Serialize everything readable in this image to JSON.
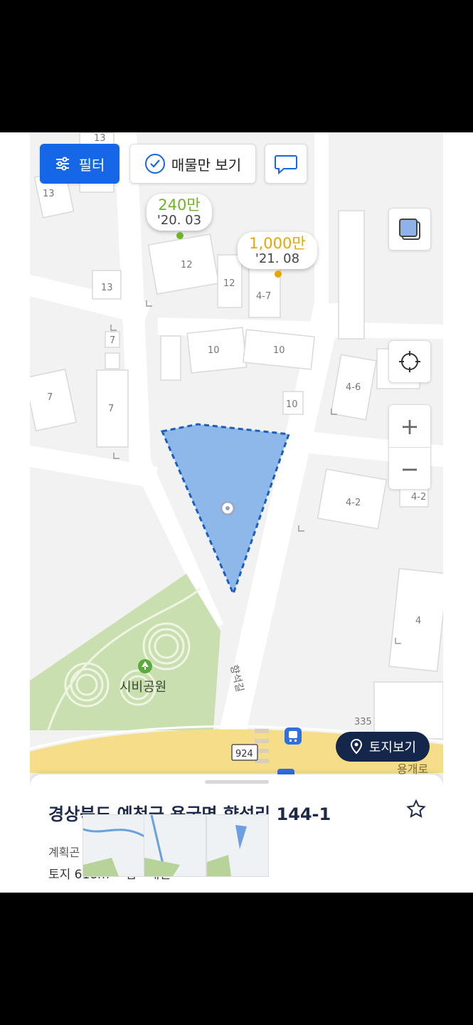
{
  "toolbar": {
    "filter_label": "필터",
    "listing_only_label": "매물만 보기"
  },
  "price_tags": [
    {
      "price": "240만",
      "date": "'20. 03",
      "color": "#72b22a"
    },
    {
      "price": "1,000만",
      "date": "'21. 08",
      "color": "#e8a700"
    }
  ],
  "map_labels": {
    "buildings": [
      "13",
      "13",
      "13",
      "12",
      "12",
      "4-7",
      "7",
      "7",
      "7",
      "10",
      "10",
      "10",
      "4-6",
      "4-2",
      "4-2",
      "4",
      "335"
    ],
    "park_name": "시비공원",
    "road_name": "향석길",
    "route_number": "924",
    "road_bottom": "용개로"
  },
  "land_view_label": "토지보기",
  "sheet": {
    "address": "경상북도 예천군 용궁면 향석리 144-1",
    "plan_label": "계획곤",
    "land_info": "토지 618m² · 답 · 개인"
  },
  "colors": {
    "primary": "#1567e8",
    "parcel_fill": "#8fb8ea",
    "parcel_border": "#1a5fc0",
    "park": "#c9dfb0",
    "main_road": "#f6dd8a",
    "land_button": "#14264a"
  },
  "icons": [
    "filter-icon",
    "check-circle-icon",
    "chat-icon",
    "layers-icon",
    "crosshair-icon",
    "plus-icon",
    "minus-icon",
    "tree-icon",
    "bus-icon",
    "pin-icon",
    "star-icon"
  ]
}
